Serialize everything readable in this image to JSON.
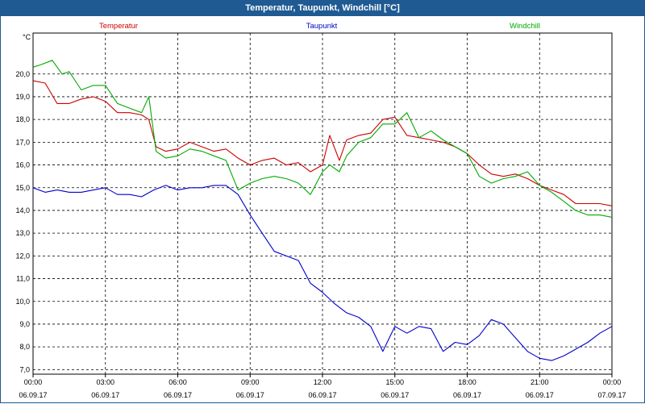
{
  "window": {
    "title": "Temperatur, Taupunkt, Windchill [°C]"
  },
  "chart_data": {
    "type": "line",
    "title": "Temperatur, Taupunkt, Windchill [°C]",
    "ylabel": "°C",
    "ylim": [
      6.8,
      21.8
    ],
    "xlim": [
      0,
      24
    ],
    "grid": true,
    "legend_placement": "top",
    "y_ticks": [
      "7,0",
      "8,0",
      "9,0",
      "10,0",
      "11,0",
      "12,0",
      "13,0",
      "14,0",
      "15,0",
      "16,0",
      "17,0",
      "18,0",
      "19,0",
      "20,0"
    ],
    "x_ticks": [
      {
        "time": "00:00",
        "date": "06.09.17"
      },
      {
        "time": "03:00",
        "date": "06.09.17"
      },
      {
        "time": "06:00",
        "date": "06.09.17"
      },
      {
        "time": "09:00",
        "date": "06.09.17"
      },
      {
        "time": "12:00",
        "date": "06.09.17"
      },
      {
        "time": "15:00",
        "date": "06.09.17"
      },
      {
        "time": "18:00",
        "date": "06.09.17"
      },
      {
        "time": "21:00",
        "date": "06.09.17"
      },
      {
        "time": "00:00",
        "date": "07.09.17"
      }
    ],
    "series": [
      {
        "name": "Temperatur",
        "color": "#cc0000",
        "x": [
          0,
          0.5,
          1,
          1.5,
          2,
          2.5,
          3,
          3.5,
          4,
          4.5,
          4.8,
          5.1,
          5.5,
          6,
          6.5,
          7,
          7.5,
          8,
          8.5,
          9,
          9.5,
          10,
          10.5,
          11,
          11.5,
          12,
          12.3,
          12.7,
          13,
          13.5,
          14,
          14.5,
          15,
          15.5,
          16,
          16.5,
          17,
          17.5,
          18,
          18.5,
          19,
          19.5,
          20,
          20.5,
          21,
          21.5,
          22,
          22.5,
          23,
          23.5,
          24
        ],
        "y": [
          19.7,
          19.6,
          18.7,
          18.7,
          18.9,
          19.0,
          18.8,
          18.3,
          18.3,
          18.2,
          18.0,
          16.8,
          16.6,
          16.7,
          17.0,
          16.8,
          16.6,
          16.7,
          16.3,
          16.0,
          16.2,
          16.3,
          16.0,
          16.1,
          15.7,
          16.0,
          17.3,
          16.2,
          17.1,
          17.3,
          17.4,
          18.0,
          18.1,
          17.3,
          17.2,
          17.1,
          17.0,
          16.8,
          16.5,
          16.0,
          15.6,
          15.5,
          15.6,
          15.4,
          15.1,
          14.9,
          14.7,
          14.3,
          14.3,
          14.3,
          14.2
        ]
      },
      {
        "name": "Taupunkt",
        "color": "#0000cc",
        "x": [
          0,
          0.5,
          1,
          1.5,
          2,
          2.5,
          3,
          3.5,
          4,
          4.5,
          5,
          5.5,
          6,
          6.5,
          7,
          7.5,
          8,
          8.5,
          9,
          9.5,
          10,
          10.5,
          11,
          11.5,
          12,
          12.5,
          13,
          13.5,
          14,
          14.5,
          15,
          15.5,
          16,
          16.5,
          17,
          17.5,
          18,
          18.5,
          19,
          19.5,
          20,
          20.5,
          21,
          21.5,
          22,
          22.5,
          23,
          23.5,
          24
        ],
        "y": [
          15.0,
          14.8,
          14.9,
          14.8,
          14.8,
          14.9,
          15.0,
          14.7,
          14.7,
          14.6,
          14.9,
          15.1,
          14.9,
          15.0,
          15.0,
          15.1,
          15.1,
          14.7,
          13.8,
          13.0,
          12.2,
          12.0,
          11.8,
          10.8,
          10.4,
          9.9,
          9.5,
          9.3,
          8.9,
          7.8,
          8.9,
          8.6,
          8.9,
          8.8,
          7.8,
          8.2,
          8.1,
          8.5,
          9.2,
          9.0,
          8.4,
          7.8,
          7.5,
          7.4,
          7.6,
          7.9,
          8.2,
          8.6,
          8.9
        ]
      },
      {
        "name": "Windchill",
        "color": "#00aa00",
        "x": [
          0,
          0.3,
          0.8,
          1.2,
          1.5,
          2,
          2.5,
          3,
          3.5,
          4,
          4.5,
          4.8,
          5.1,
          5.5,
          6,
          6.5,
          7,
          7.5,
          8,
          8.5,
          9,
          9.5,
          10,
          10.5,
          11,
          11.5,
          12,
          12.3,
          12.7,
          13,
          13.5,
          14,
          14.5,
          15,
          15.5,
          16,
          16.5,
          17,
          17.5,
          18,
          18.5,
          19,
          19.5,
          20,
          20.5,
          21,
          21.5,
          22,
          22.5,
          23,
          23.5,
          24
        ],
        "y": [
          20.3,
          20.4,
          20.6,
          20.0,
          20.1,
          19.3,
          19.5,
          19.5,
          18.7,
          18.5,
          18.3,
          19.0,
          16.6,
          16.3,
          16.4,
          16.7,
          16.6,
          16.4,
          16.2,
          14.9,
          15.2,
          15.4,
          15.5,
          15.4,
          15.2,
          14.7,
          15.7,
          16.0,
          15.7,
          16.4,
          17.0,
          17.2,
          17.8,
          17.8,
          18.3,
          17.2,
          17.5,
          17.1,
          16.8,
          16.5,
          15.5,
          15.2,
          15.4,
          15.5,
          15.7,
          15.1,
          14.8,
          14.4,
          14.0,
          13.8,
          13.8,
          13.7
        ]
      }
    ]
  }
}
